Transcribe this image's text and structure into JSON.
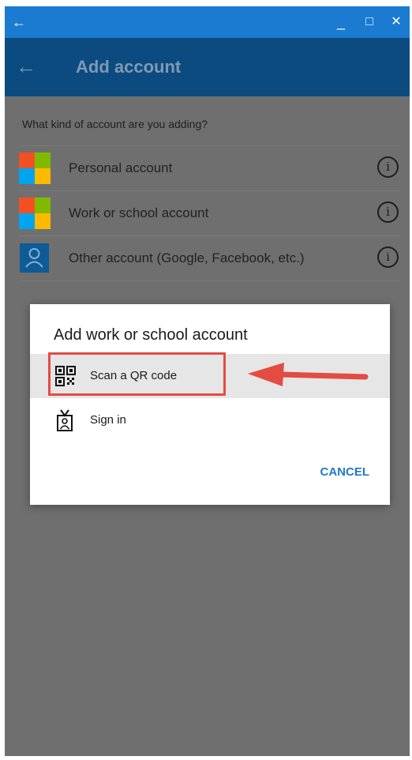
{
  "window": {
    "back_glyph": "←",
    "minimize_glyph": "_",
    "maximize_glyph": "□",
    "close_glyph": "✕"
  },
  "app_bar": {
    "back_glyph": "←",
    "title": "Add account"
  },
  "content": {
    "question": "What kind of account are you adding?",
    "accounts": [
      {
        "label": "Personal account",
        "icon": "microsoft-logo",
        "info": "i"
      },
      {
        "label": "Work or school account",
        "icon": "microsoft-logo",
        "info": "i"
      },
      {
        "label": "Other account (Google, Facebook, etc.)",
        "icon": "person-icon",
        "info": "i"
      }
    ]
  },
  "dialog": {
    "title": "Add work or school account",
    "options": [
      {
        "label": "Scan a QR code",
        "icon": "qr-code-icon",
        "highlighted": true
      },
      {
        "label": "Sign in",
        "icon": "badge-icon",
        "highlighted": false
      }
    ],
    "cancel_label": "CANCEL"
  },
  "colors": {
    "title_bar": "#1a7bd1",
    "app_bar": "#0c4b7f",
    "accent": "#1f7ac9",
    "annotation": "#e24c43",
    "ms_red": "#f25022",
    "ms_green": "#7fba00",
    "ms_blue": "#00a4ef",
    "ms_yellow": "#ffb900"
  }
}
